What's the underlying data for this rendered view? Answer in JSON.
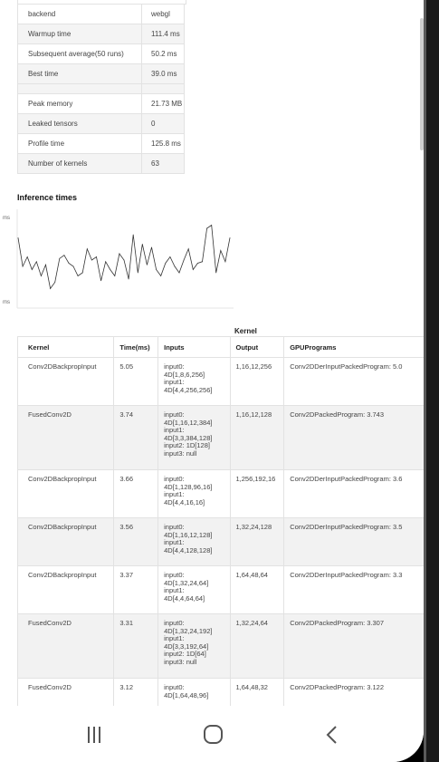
{
  "stats": [
    {
      "label": "backend",
      "value": "webgl"
    },
    {
      "label": "Warmup time",
      "value": "111.4 ms"
    },
    {
      "label": "Subsequent average(50 runs)",
      "value": "50.2 ms"
    },
    {
      "label": "Best time",
      "value": "39.0 ms"
    },
    {
      "label": "Peak memory",
      "value": "21.73 MB"
    },
    {
      "label": "Leaked tensors",
      "value": "0"
    },
    {
      "label": "Profile time",
      "value": "125.8 ms"
    },
    {
      "label": "Number of kernels",
      "value": "63"
    }
  ],
  "inference": {
    "title": "Inference times",
    "y_top_label": "ms",
    "y_bottom_label": "ms"
  },
  "chart_data": {
    "type": "line",
    "title": "Inference times",
    "series": [
      {
        "values": [
          62,
          44,
          50,
          42,
          47,
          38,
          45,
          30,
          34,
          49,
          51,
          46,
          44,
          38,
          40,
          55,
          48,
          50,
          35,
          47,
          42,
          38,
          52,
          48,
          36,
          64,
          40,
          58,
          45,
          56,
          42,
          38,
          46,
          50,
          44,
          40,
          48,
          55,
          42,
          46,
          47,
          68,
          70,
          40,
          54,
          47,
          62
        ]
      }
    ],
    "ylim": [
      20,
      80
    ]
  },
  "kernels": {
    "caption": "Kernel",
    "headers": [
      "Kernel",
      "Time(ms)",
      "Inputs",
      "Output",
      "GPUPrograms"
    ],
    "rows": [
      {
        "kernel": "Conv2DBackpropInput",
        "time": "5.05",
        "inputs": "input0:\n4D[1,8,6,256]\ninput1:\n4D[4,4,256,256]",
        "output": "1,16,12,256",
        "programs": "Conv2DDerInputPackedProgram: 5.0"
      },
      {
        "kernel": "FusedConv2D",
        "time": "3.74",
        "inputs": "input0:\n4D[1,16,12,384]\ninput1:\n4D[3,3,384,128]\ninput2: 1D[128]\ninput3: null",
        "output": "1,16,12,128",
        "programs": "Conv2DPackedProgram: 3.743"
      },
      {
        "kernel": "Conv2DBackpropInput",
        "time": "3.66",
        "inputs": "input0:\n4D[1,128,96,16]\ninput1:\n4D[4,4,16,16]",
        "output": "1,256,192,16",
        "programs": "Conv2DDerInputPackedProgram: 3.6"
      },
      {
        "kernel": "Conv2DBackpropInput",
        "time": "3.56",
        "inputs": "input0:\n4D[1,16,12,128]\ninput1:\n4D[4,4,128,128]",
        "output": "1,32,24,128",
        "programs": "Conv2DDerInputPackedProgram: 3.5"
      },
      {
        "kernel": "Conv2DBackpropInput",
        "time": "3.37",
        "inputs": "input0:\n4D[1,32,24,64]\ninput1:\n4D[4,4,64,64]",
        "output": "1,64,48,64",
        "programs": "Conv2DDerInputPackedProgram: 3.3"
      },
      {
        "kernel": "FusedConv2D",
        "time": "3.31",
        "inputs": "input0:\n4D[1,32,24,192]\ninput1:\n4D[3,3,192,64]\ninput2: 1D[64]\ninput3: null",
        "output": "1,32,24,64",
        "programs": "Conv2DPackedProgram: 3.307"
      },
      {
        "kernel": "FusedConv2D",
        "time": "3.12",
        "inputs": "input0:\n4D[1,64,48,96]",
        "output": "1,64,48,32",
        "programs": "Conv2DPackedProgram: 3.122"
      }
    ]
  },
  "nav": {
    "icons": [
      "recent-apps-icon",
      "home-icon",
      "back-icon"
    ]
  }
}
